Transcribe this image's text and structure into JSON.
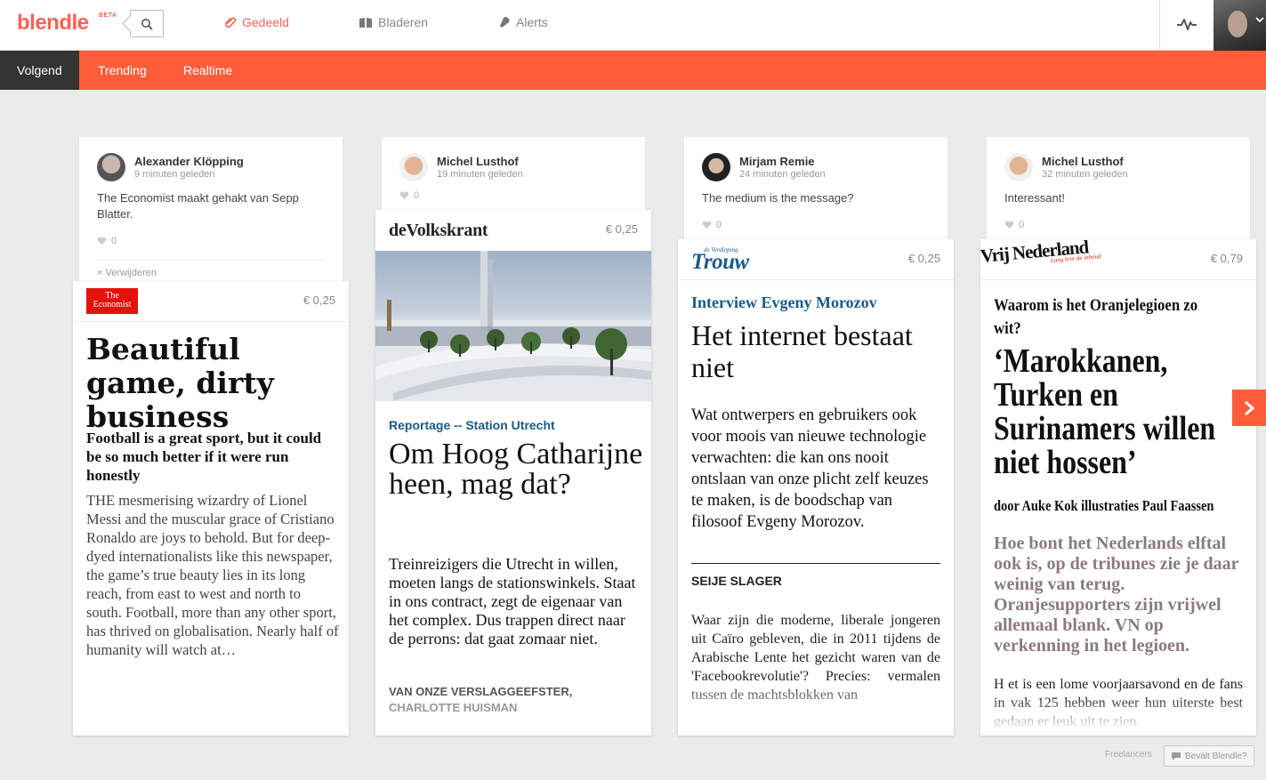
{
  "app": {
    "logo": "blendle",
    "beta": "BETA"
  },
  "nav": {
    "items": [
      {
        "label": "Gedeeld"
      },
      {
        "label": "Bladeren"
      },
      {
        "label": "Alerts"
      }
    ]
  },
  "subnav": {
    "tabs": [
      {
        "label": "Volgend"
      },
      {
        "label": "Trending"
      },
      {
        "label": "Realtime"
      }
    ]
  },
  "colors": {
    "accent": "#ff5d3a",
    "brand": "#ff6255"
  },
  "posts": [
    {
      "user": "Alexander Klöpping",
      "time": "9 minuten geleden",
      "comment": "The Economist maakt gehakt van Sepp Blatter.",
      "likes": "0",
      "remove": "Verwijderen",
      "article": {
        "publication": "The Economist",
        "price": "€ 0,25",
        "headline": "Beautiful game, dirty business",
        "standfirst": "Football is a great sport, but it could be so much better if it were run honestly",
        "body": "THE mesmerising wizardry of Lionel Messi and the muscular grace of Cristiano Ronaldo are joys to behold. But for deep-dyed internationalists like this newspaper, the game’s true beauty lies in its long reach, from east to west and north to south. Football, more than any other sport, has thrived on globalisation. Nearly half of humanity will watch at…"
      }
    },
    {
      "user": "Michel Lusthof",
      "time": "19 minuten geleden",
      "likes": "0",
      "article": {
        "publication": "deVolkskrant",
        "price": "€ 0,25",
        "kicker": "Reportage -- Station Utrecht",
        "headline": "Om Hoog Catharijne heen, mag dat?",
        "body": "Treinreizigers die Utrecht in willen, moeten langs de stationswinkels. Staat in ons contract, zegt de eigenaar van het complex. Dus trappen direct naar de perrons: dat gaat zomaar niet.",
        "byline1": "VAN ONZE VERSLAGGEEFSTER,",
        "byline2": "CHARLOTTE HUISMAN"
      }
    },
    {
      "user": "Mirjam Remie",
      "time": "24 minuten geleden",
      "comment": "The medium is the message?",
      "likes": "0",
      "article": {
        "publication_small": "de Verdieping",
        "publication": "Trouw",
        "price": "€ 0,25",
        "kicker": "Interview Evgeny Morozov",
        "headline": "Het internet bestaat niet",
        "standfirst": "Wat ontwerpers en gebruikers ook voor moois van nieuwe technologie verwachten: die kan ons nooit ontslaan van onze plicht zelf keuzes te maken, is de boodschap van filosoof Evgeny Morozov.",
        "author": "SEIJE SLAGER",
        "body": "Waar zijn die moderne, liberale jongeren uit Caïro gebleven, die in 2011 tijdens de Arabische Lente het gezicht waren van de 'Facebookrevolutie'? Precies: vermalen tussen de machtsblokken van"
      }
    },
    {
      "user": "Michel Lusthof",
      "time": "32 minuten geleden",
      "comment": "Interessant!",
      "likes": "0",
      "article": {
        "publication": "Vrij Nederland",
        "tagline": "Lang leve de inhoud",
        "price": "€ 0,79",
        "kicker": "Waarom is het Oranjelegioen zo wit?",
        "headline": "‘Marokkanen, Turken en Surinamers willen niet hossen’",
        "byline": "door Auke Kok illustraties Paul Faassen",
        "standfirst": "Hoe bont het Nederlands elftal ook is, op de tribunes zie je daar weinig van terug. Oranjesupporters zijn vrijwel allemaal blank. VN op verkenning in het legioen.",
        "body": "H et is een lome voorjaarsavond en de fans in vak 125 hebben weer hun uiterste best gedaan er leuk uit te zien."
      }
    }
  ],
  "footer": {
    "freelancers": "Freelancers",
    "feedback": "Bevalt Blendle?"
  }
}
